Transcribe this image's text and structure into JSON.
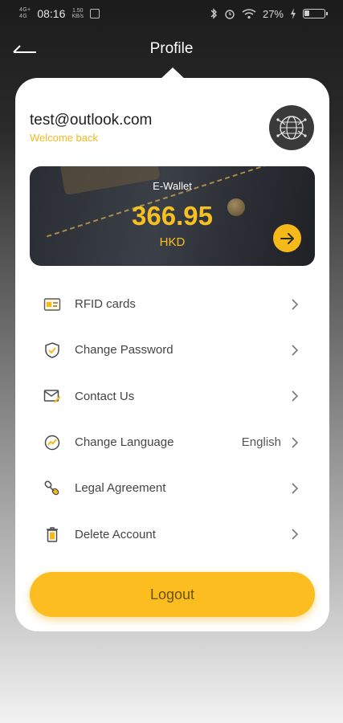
{
  "status_bar": {
    "network_label_top": "4G+",
    "network_label_bottom": "4G",
    "time": "08:16",
    "speed_value": "1.50",
    "speed_unit": "KB/s",
    "battery_percent": "27%",
    "battery_level": 0.27
  },
  "header": {
    "title": "Profile",
    "back_icon": "arrow-left-icon"
  },
  "account": {
    "email": "test@outlook.com",
    "welcome": "Welcome back",
    "avatar_icon": "globe-network-icon"
  },
  "wallet": {
    "title": "E-Wallet",
    "amount": "366.95",
    "currency": "HKD",
    "arrow_icon": "arrow-right-icon"
  },
  "menu": {
    "items": [
      {
        "label": "RFID cards",
        "value": "",
        "icon": "rfid-card-icon"
      },
      {
        "label": "Change Password",
        "value": "",
        "icon": "shield-check-icon"
      },
      {
        "label": "Contact Us",
        "value": "",
        "icon": "mail-icon"
      },
      {
        "label": "Change Language",
        "value": "English",
        "icon": "language-icon"
      },
      {
        "label": "Legal Agreement",
        "value": "",
        "icon": "link-icon"
      },
      {
        "label": "Delete Account",
        "value": "",
        "icon": "trash-icon"
      }
    ]
  },
  "logout": {
    "label": "Logout"
  },
  "colors": {
    "accent": "#fbbd1f",
    "accent_text": "#f3b81e",
    "wallet_bg": "#2f3238",
    "card_bg": "#ffffff"
  }
}
